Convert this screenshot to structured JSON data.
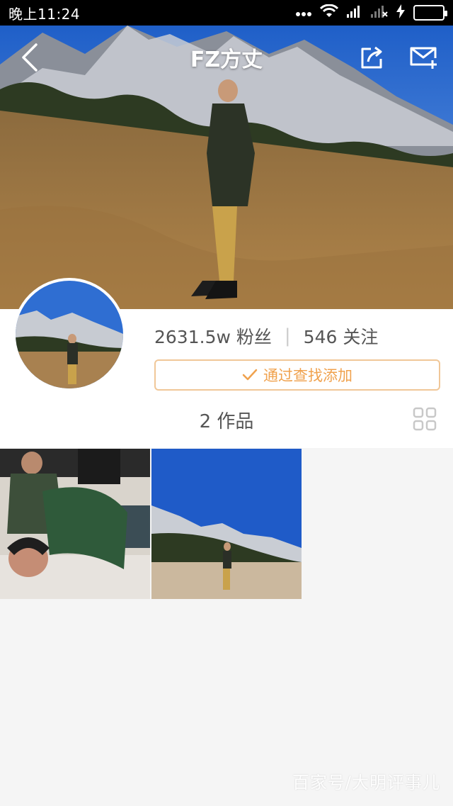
{
  "status_bar": {
    "time": "晚上11:24",
    "battery_color": "#43c443",
    "icons": [
      "more-dots-icon",
      "wifi-icon",
      "signal-icon",
      "signal-off-icon",
      "charging-icon",
      "battery-icon"
    ]
  },
  "header": {
    "title": "FZ方丈",
    "back_icon": "back-icon",
    "share_icon": "share-icon",
    "message_icon": "message-add-icon"
  },
  "profile": {
    "followers_count": "2631.5w",
    "followers_label": "粉丝",
    "following_count": "546",
    "following_label": "关注",
    "add_button_label": "通过查找添加",
    "add_button_color": "#f0a24e"
  },
  "works": {
    "label": "2 作品",
    "count": 2,
    "items": [
      {
        "name": "work-thumb-1"
      },
      {
        "name": "work-thumb-2"
      }
    ]
  },
  "watermark": "百家号/大明评事儿"
}
